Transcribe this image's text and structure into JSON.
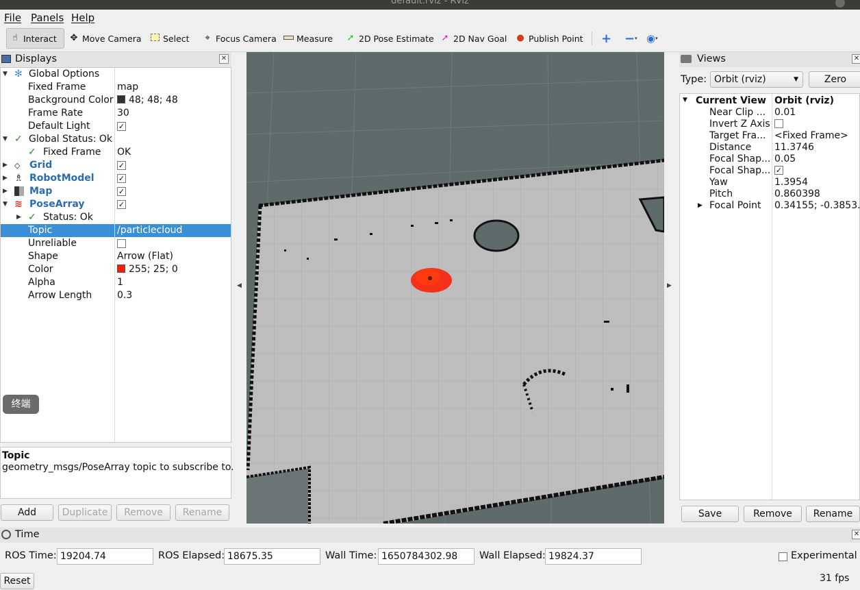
{
  "window": {
    "title": "default.rviz - RViz"
  },
  "menu": {
    "file": "File",
    "panels": "Panels",
    "help": "Help"
  },
  "toolbar": {
    "interact": "Interact",
    "move_camera": "Move Camera",
    "select": "Select",
    "focus_camera": "Focus Camera",
    "measure": "Measure",
    "pose_estimate": "2D Pose Estimate",
    "nav_goal": "2D Nav Goal",
    "publish_point": "Publish Point"
  },
  "displays": {
    "title": "Displays",
    "global_options": "Global Options",
    "fixed_frame_label": "Fixed Frame",
    "fixed_frame_value": "map",
    "bg_color_label": "Background Color",
    "bg_color_value": "48; 48; 48",
    "bg_color_hex": "#303030",
    "frame_rate_label": "Frame Rate",
    "frame_rate_value": "30",
    "default_light_label": "Default Light",
    "global_status_label": "Global Status: Ok",
    "status_fixed_frame_label": "Fixed Frame",
    "status_fixed_frame_value": "OK",
    "grid": "Grid",
    "robot_model": "RobotModel",
    "map": "Map",
    "pose_array": "PoseArray",
    "status_ok": "Status: Ok",
    "topic_label": "Topic",
    "topic_value": "/particlecloud",
    "unreliable_label": "Unreliable",
    "shape_label": "Shape",
    "shape_value": "Arrow (Flat)",
    "color_label": "Color",
    "color_value": "255; 25; 0",
    "color_hex": "#ff1900",
    "alpha_label": "Alpha",
    "alpha_value": "1",
    "arrow_length_label": "Arrow Length",
    "arrow_length_value": "0.3"
  },
  "terminal_badge": "终端",
  "description": {
    "title": "Topic",
    "text": "geometry_msgs/PoseArray topic to subscribe to."
  },
  "display_buttons": {
    "add": "Add",
    "duplicate": "Duplicate",
    "remove": "Remove",
    "rename": "Rename"
  },
  "views": {
    "title": "Views",
    "type_label": "Type:",
    "type_value": "Orbit (rviz)",
    "zero": "Zero",
    "current_view_label": "Current View",
    "current_view_value": "Orbit (rviz)",
    "near_clip_label": "Near Clip ...",
    "near_clip_value": "0.01",
    "invert_z_label": "Invert Z Axis",
    "target_frame_label": "Target Fra...",
    "target_frame_value": "<Fixed Frame>",
    "distance_label": "Distance",
    "distance_value": "11.3746",
    "focal_shape1_label": "Focal Shap...",
    "focal_shape1_value": "0.05",
    "focal_shape2_label": "Focal Shap...",
    "yaw_label": "Yaw",
    "yaw_value": "1.3954",
    "pitch_label": "Pitch",
    "pitch_value": "0.860398",
    "focal_point_label": "Focal Point",
    "focal_point_value": "0.34155; -0.3853...",
    "save": "Save",
    "remove": "Remove",
    "rename": "Rename"
  },
  "time": {
    "title": "Time",
    "ros_time_label": "ROS Time:",
    "ros_time_value": "19204.74",
    "ros_elapsed_label": "ROS Elapsed:",
    "ros_elapsed_value": "18675.35",
    "wall_time_label": "Wall Time:",
    "wall_time_value": "1650784302.98",
    "wall_elapsed_label": "Wall Elapsed:",
    "wall_elapsed_value": "19824.37",
    "experimental_label": "Experimental",
    "reset": "Reset",
    "fps": "31 fps"
  }
}
